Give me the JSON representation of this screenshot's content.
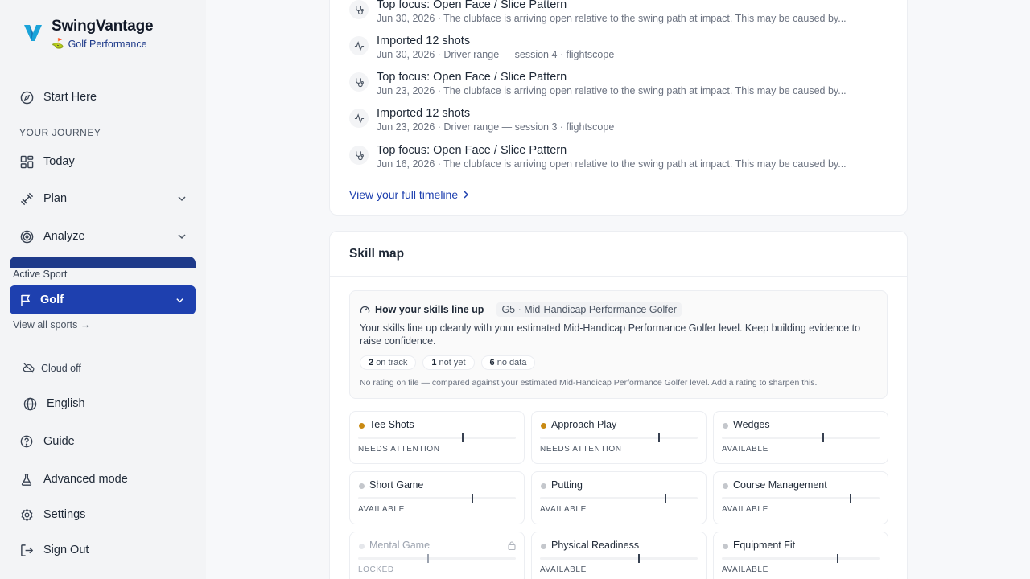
{
  "brand": {
    "name": "SwingVantage",
    "subtitle": "Golf Performance",
    "emoji": "⛳"
  },
  "sidebar": {
    "start_here": "Start Here",
    "section_label": "YOUR JOURNEY",
    "today": "Today",
    "plan": "Plan",
    "analyze": "Analyze",
    "active_sport_label": "Active Sport",
    "active_sport": "Golf",
    "view_all_sports": "View all sports →",
    "cloud_status": "Cloud off",
    "language": "English",
    "guide": "Guide",
    "advanced_mode": "Advanced mode",
    "settings": "Settings",
    "sign_out": "Sign Out"
  },
  "timeline": {
    "items": [
      {
        "icon": "stethoscope-icon",
        "title": "Top focus: Open Face / Slice Pattern",
        "sub": "Jun 30, 2026 · The clubface is arriving open relative to the swing path at impact. This may be caused by..."
      },
      {
        "icon": "activity-icon",
        "title": "Imported 12 shots",
        "sub": "Jun 30, 2026 · Driver range — session 4 · flightscope"
      },
      {
        "icon": "stethoscope-icon",
        "title": "Top focus: Open Face / Slice Pattern",
        "sub": "Jun 23, 2026 · The clubface is arriving open relative to the swing path at impact. This may be caused by..."
      },
      {
        "icon": "activity-icon",
        "title": "Imported 12 shots",
        "sub": "Jun 23, 2026 · Driver range — session 3 · flightscope"
      },
      {
        "icon": "stethoscope-icon",
        "title": "Top focus: Open Face / Slice Pattern",
        "sub": "Jun 16, 2026 · The clubface is arriving open relative to the swing path at impact. This may be caused by..."
      }
    ],
    "view_full": "View your full timeline"
  },
  "skill_map": {
    "title": "Skill map",
    "lineup_title": "How your skills line up",
    "level_badge": "G5 · Mid-Handicap Performance Golfer",
    "description": "Your skills line up cleanly with your estimated Mid-Handicap Performance Golfer level. Keep building evidence to raise confidence.",
    "chips": [
      {
        "count": "2",
        "label": "on track"
      },
      {
        "count": "1",
        "label": "not yet"
      },
      {
        "count": "6",
        "label": "no data"
      }
    ],
    "note": "No rating on file — compared against your estimated Mid-Handicap Performance Golfer level. Add a rating to sharpen this.",
    "tiles": [
      {
        "name": "Tee Shots",
        "status": "NEEDS ATTENTION",
        "dot": "#c98a12",
        "level": 0.66,
        "locked": false
      },
      {
        "name": "Approach Play",
        "status": "NEEDS ATTENTION",
        "dot": "#c98a12",
        "level": 0.75,
        "locked": false
      },
      {
        "name": "Wedges",
        "status": "AVAILABLE",
        "dot": "#c4c7cc",
        "level": 0.64,
        "locked": false
      },
      {
        "name": "Short Game",
        "status": "AVAILABLE",
        "dot": "#c4c7cc",
        "level": 0.72,
        "locked": false
      },
      {
        "name": "Putting",
        "status": "AVAILABLE",
        "dot": "#c4c7cc",
        "level": 0.79,
        "locked": false
      },
      {
        "name": "Course Management",
        "status": "AVAILABLE",
        "dot": "#c4c7cc",
        "level": 0.81,
        "locked": false
      },
      {
        "name": "Mental Game",
        "status": "LOCKED",
        "dot": "#e5e7eb",
        "level": 0.44,
        "locked": true
      },
      {
        "name": "Physical Readiness",
        "status": "AVAILABLE",
        "dot": "#c4c7cc",
        "level": 0.62,
        "locked": false
      },
      {
        "name": "Equipment Fit",
        "status": "AVAILABLE",
        "dot": "#c4c7cc",
        "level": 0.73,
        "locked": false
      }
    ]
  },
  "colors": {
    "accent": "#1e40af",
    "brand_dark": "#1e3a8a",
    "attention": "#c98a12"
  }
}
